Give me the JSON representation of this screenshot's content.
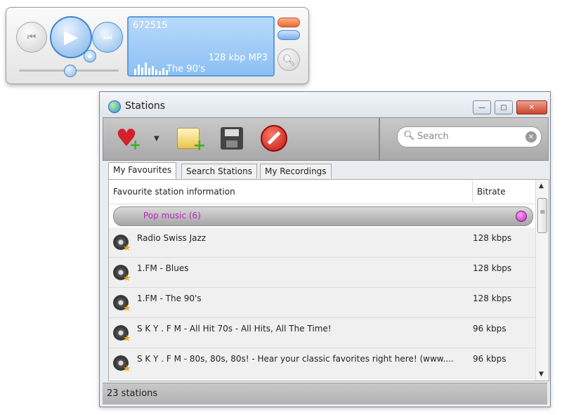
{
  "player": {
    "display_top": "672515",
    "bitrate_format": "128 kbp  MP3",
    "station": "The 90's",
    "eq_levels": [
      0.45,
      0.75,
      0.55,
      0.9,
      0.5,
      0.65,
      0.4,
      0.3,
      0.5,
      0.35
    ]
  },
  "window": {
    "title": "Stations",
    "controls": {
      "minimize": "—",
      "maximize": "▢",
      "close": "✕"
    }
  },
  "search": {
    "placeholder": "Search"
  },
  "tabs": [
    {
      "label": "My Favourites",
      "active": true
    },
    {
      "label": "Search Stations",
      "active": false
    },
    {
      "label": "My Recordings",
      "active": false
    }
  ],
  "list": {
    "columns": {
      "info": "Favourite station information",
      "bitrate": "Bitrate"
    },
    "group": "Pop music (6)",
    "rows": [
      {
        "name": "Radio Swiss Jazz",
        "bitrate": "128 kbps"
      },
      {
        "name": "1.FM - Blues",
        "bitrate": "128 kbps"
      },
      {
        "name": "1.FM - The 90's",
        "bitrate": "128 kbps"
      },
      {
        "name": "S K Y . F M - All Hit 70s - All Hits, All The Time!",
        "bitrate": "96 kbps"
      },
      {
        "name": "S K Y . F M - 80s, 80s, 80s! - Hear your classic favorites right here! (www....",
        "bitrate": "96 kbps"
      }
    ]
  },
  "status": {
    "text": "23 stations"
  },
  "colors": {
    "accent": "#3f86d1",
    "group_text": "#c020c0",
    "heart": "#d3202a",
    "add_green": "#3dae2b"
  }
}
